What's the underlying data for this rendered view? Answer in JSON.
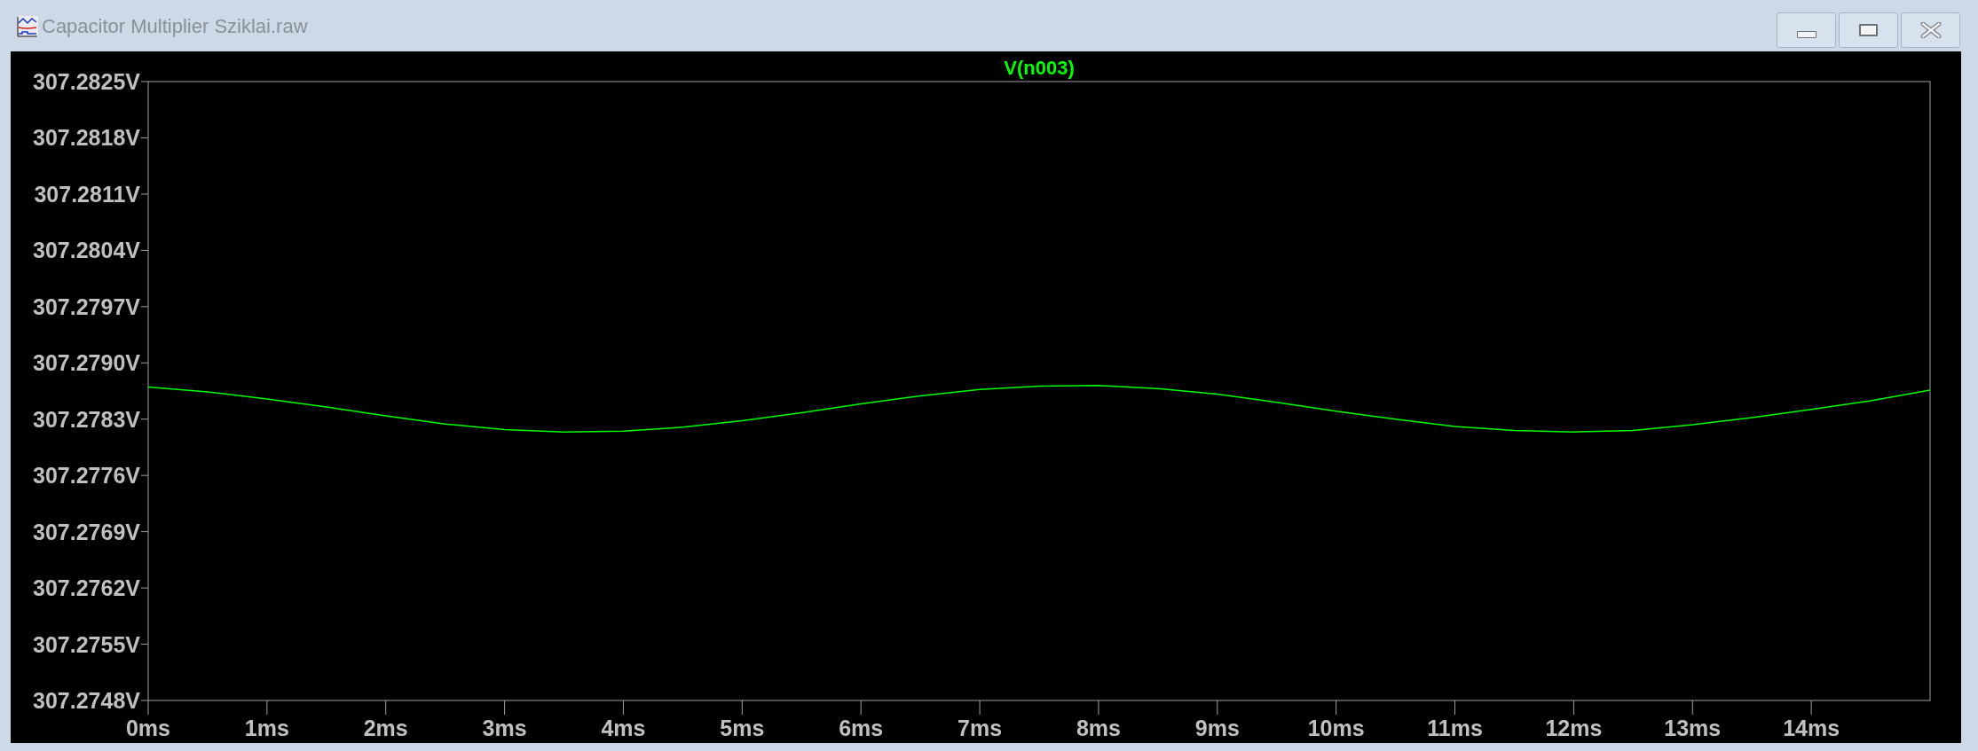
{
  "window": {
    "title": "Capacitor Multiplier Sziklai.raw"
  },
  "plot": {
    "chart_data": {
      "type": "line",
      "x": [
        0,
        0.5,
        1,
        1.5,
        2,
        2.5,
        3,
        3.5,
        4,
        4.5,
        5,
        5.5,
        6,
        6.5,
        7,
        7.5,
        8,
        8.5,
        9,
        9.5,
        10,
        10.5,
        11,
        11.5,
        12,
        12.5,
        13,
        13.5,
        14,
        14.5,
        15
      ],
      "series": [
        {
          "name": "V(n003)",
          "color": "#00ff00",
          "values": [
            307.2787,
            307.27864,
            307.27855,
            307.27845,
            307.27834,
            307.27824,
            307.27817,
            307.27814,
            307.27815,
            307.2782,
            307.27828,
            307.27838,
            307.27849,
            307.27859,
            307.27867,
            307.27871,
            307.27872,
            307.27868,
            307.27861,
            307.27851,
            307.2784,
            307.2783,
            307.27821,
            307.27816,
            307.27814,
            307.27816,
            307.27823,
            307.27832,
            307.27842,
            307.27853,
            307.27866
          ]
        }
      ],
      "xlim": [
        0,
        15
      ],
      "ylim": [
        307.2748,
        307.2825
      ],
      "xticks": [
        {
          "value": 0,
          "label": "0ms"
        },
        {
          "value": 1,
          "label": "1ms"
        },
        {
          "value": 2,
          "label": "2ms"
        },
        {
          "value": 3,
          "label": "3ms"
        },
        {
          "value": 4,
          "label": "4ms"
        },
        {
          "value": 5,
          "label": "5ms"
        },
        {
          "value": 6,
          "label": "6ms"
        },
        {
          "value": 7,
          "label": "7ms"
        },
        {
          "value": 8,
          "label": "8ms"
        },
        {
          "value": 9,
          "label": "9ms"
        },
        {
          "value": 10,
          "label": "10ms"
        },
        {
          "value": 11,
          "label": "11ms"
        },
        {
          "value": 12,
          "label": "12ms"
        },
        {
          "value": 13,
          "label": "13ms"
        },
        {
          "value": 14,
          "label": "14ms"
        }
      ],
      "yticks": [
        {
          "value": 307.2825,
          "label": "307.2825V"
        },
        {
          "value": 307.2818,
          "label": "307.2818V"
        },
        {
          "value": 307.2811,
          "label": "307.2811V"
        },
        {
          "value": 307.2804,
          "label": "307.2804V"
        },
        {
          "value": 307.2797,
          "label": "307.2797V"
        },
        {
          "value": 307.279,
          "label": "307.2790V"
        },
        {
          "value": 307.2783,
          "label": "307.2783V"
        },
        {
          "value": 307.2776,
          "label": "307.2776V"
        },
        {
          "value": 307.2769,
          "label": "307.2769V"
        },
        {
          "value": 307.2762,
          "label": "307.2762V"
        },
        {
          "value": 307.2755,
          "label": "307.2755V"
        },
        {
          "value": 307.2748,
          "label": "307.2748V"
        }
      ]
    }
  }
}
